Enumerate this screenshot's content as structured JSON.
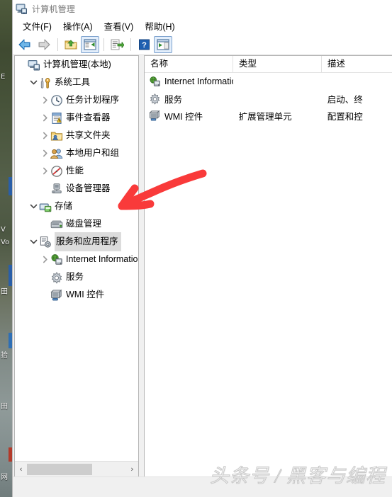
{
  "window": {
    "title": "计算机管理",
    "title_icon": "computer-management-icon"
  },
  "menubar": {
    "items": [
      {
        "label": "文件(F)",
        "name": "menu-file"
      },
      {
        "label": "操作(A)",
        "name": "menu-action"
      },
      {
        "label": "查看(V)",
        "name": "menu-view"
      },
      {
        "label": "帮助(H)",
        "name": "menu-help"
      }
    ]
  },
  "toolbar": {
    "buttons": [
      {
        "icon": "back-arrow-icon",
        "label": "后退",
        "active": false
      },
      {
        "icon": "forward-arrow-icon",
        "label": "前进",
        "active": false
      },
      {
        "icon": "up-folder-icon",
        "label": "上移一级",
        "active": false
      },
      {
        "icon": "show-hide-tree-icon",
        "label": "显示/隐藏控制台树",
        "active": true
      },
      {
        "icon": "export-list-icon",
        "label": "导出列表",
        "active": false
      },
      {
        "icon": "help-icon",
        "label": "帮助",
        "active": false
      },
      {
        "icon": "show-action-pane-icon",
        "label": "显示/隐藏操作窗格",
        "active": true
      }
    ]
  },
  "tree": {
    "nodes": [
      {
        "label": "计算机管理(本地)",
        "icon": "computer-icon",
        "indent": 0,
        "twisty": "none",
        "selected": false
      },
      {
        "label": "系统工具",
        "icon": "system-tools-icon",
        "indent": 1,
        "twisty": "expanded",
        "selected": false
      },
      {
        "label": "任务计划程序",
        "icon": "task-scheduler-icon",
        "indent": 2,
        "twisty": "collapsed",
        "selected": false
      },
      {
        "label": "事件查看器",
        "icon": "event-viewer-icon",
        "indent": 2,
        "twisty": "collapsed",
        "selected": false
      },
      {
        "label": "共享文件夹",
        "icon": "shared-folders-icon",
        "indent": 2,
        "twisty": "collapsed",
        "selected": false
      },
      {
        "label": "本地用户和组",
        "icon": "local-users-groups-icon",
        "indent": 2,
        "twisty": "collapsed",
        "selected": false
      },
      {
        "label": "性能",
        "icon": "performance-icon",
        "indent": 2,
        "twisty": "collapsed",
        "selected": false
      },
      {
        "label": "设备管理器",
        "icon": "device-manager-icon",
        "indent": 2,
        "twisty": "none",
        "selected": false
      },
      {
        "label": "存储",
        "icon": "storage-icon",
        "indent": 1,
        "twisty": "expanded",
        "selected": false
      },
      {
        "label": "磁盘管理",
        "icon": "disk-management-icon",
        "indent": 2,
        "twisty": "none",
        "selected": false
      },
      {
        "label": "服务和应用程序",
        "icon": "services-applications-icon",
        "indent": 1,
        "twisty": "expanded",
        "selected": true
      },
      {
        "label": "Internet Information S",
        "icon": "iis-icon",
        "indent": 2,
        "twisty": "collapsed",
        "selected": false
      },
      {
        "label": "服务",
        "icon": "services-icon",
        "indent": 2,
        "twisty": "none",
        "selected": false
      },
      {
        "label": "WMI 控件",
        "icon": "wmi-control-icon",
        "indent": 2,
        "twisty": "none",
        "selected": false
      }
    ],
    "hscrollbar": {
      "left_arrow": "‹",
      "right_arrow": "›"
    }
  },
  "list": {
    "columns": [
      {
        "label": "名称",
        "name": "column-name"
      },
      {
        "label": "类型",
        "name": "column-type"
      },
      {
        "label": "描述",
        "name": "column-description"
      }
    ],
    "rows": [
      {
        "name": "Internet Information...",
        "type": "",
        "description": "",
        "icon": "iis-icon"
      },
      {
        "name": "服务",
        "type": "",
        "description": "启动、终",
        "icon": "services-icon"
      },
      {
        "name": "WMI 控件",
        "type": "扩展管理单元",
        "description": "配置和控",
        "icon": "wmi-control-icon"
      }
    ]
  },
  "annotation": {
    "type": "red-arrow",
    "color": "#f93a3a",
    "points_to": "服务和应用程序"
  },
  "watermark": {
    "text": "头条号 / 黑客与编程"
  },
  "colors": {
    "selection": "#dcdcdc",
    "panel_border": "#b5b5b5",
    "window_bg": "#f0f0f0",
    "annotation_red": "#f93a3a",
    "title_text": "#767676"
  }
}
